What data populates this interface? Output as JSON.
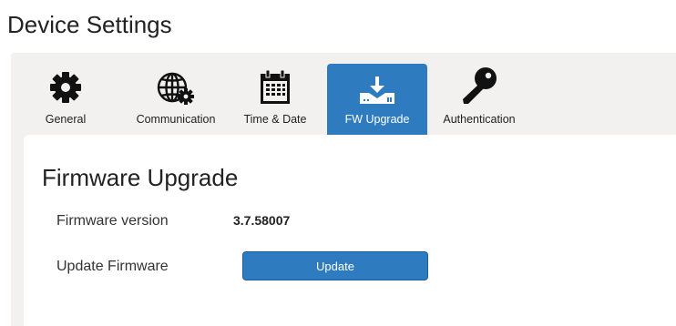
{
  "page_title": "Device Settings",
  "tabs": [
    {
      "label": "General",
      "icon": "gear-icon"
    },
    {
      "label": "Communication",
      "icon": "globe-gear-icon"
    },
    {
      "label": "Time & Date",
      "icon": "calendar-icon"
    },
    {
      "label": "FW Upgrade",
      "icon": "download-device-icon",
      "active": true
    },
    {
      "label": "Authentication",
      "icon": "key-icon"
    }
  ],
  "colors": {
    "accent": "#2e7cbf",
    "panel": "#f2f1f0"
  },
  "firmware": {
    "title": "Firmware Upgrade",
    "version_label": "Firmware version",
    "version_value": "3.7.58007",
    "update_label": "Update Firmware",
    "update_button": "Update"
  }
}
